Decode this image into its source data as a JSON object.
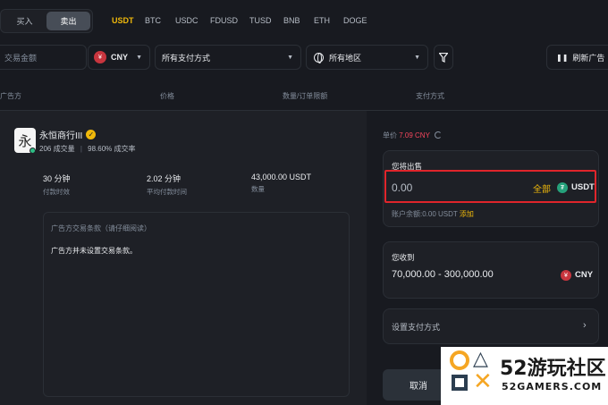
{
  "trade_toggle": {
    "buy": "买入",
    "sell": "卖出"
  },
  "coins": [
    "USDT",
    "BTC",
    "USDC",
    "FDUSD",
    "TUSD",
    "BNB",
    "ETH",
    "DOGE"
  ],
  "filters": {
    "amount_placeholder": "交易金额",
    "currency": "CNY",
    "currency_badge": "¥",
    "payment": "所有支付方式",
    "region": "所有地区",
    "refresh": "刷新广告"
  },
  "table_headers": [
    "广告方",
    "价格",
    "数量/订单限额",
    "支付方式"
  ],
  "merchant": {
    "avatar_char": "永",
    "name": "永恒商行III",
    "orders": "206 成交量",
    "completion": "98.60% 成交率",
    "stats": [
      {
        "value": "30 分钟",
        "label": "付款时效"
      },
      {
        "value": "2.02 分钟",
        "label": "平均付款时间"
      },
      {
        "value": "43,000.00 USDT",
        "label": "数量"
      }
    ],
    "terms_title": "广告方交易条款（请仔细阅读）",
    "terms_body": "广告方并未设置交易条款。"
  },
  "order": {
    "unit_price_label": "单价",
    "unit_price": "7.09 CNY",
    "sell_label": "您将出售",
    "amount": "0.00",
    "all": "全部",
    "sell_currency": "USDT",
    "balance_label": "账户余额:0.00 USDT",
    "add": "添加",
    "receive_label": "您收到",
    "receive_range": "70,000.00 - 300,000.00",
    "receive_currency": "CNY",
    "payment_setup": "设置支付方式",
    "cancel": "取消"
  },
  "watermark": {
    "brand": "52游玩社区",
    "site": "52GAMERS.COM"
  }
}
